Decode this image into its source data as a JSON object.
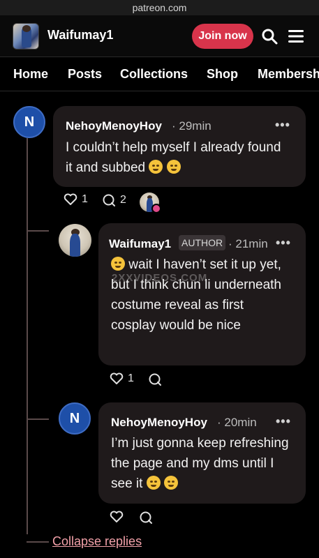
{
  "browser": {
    "url": "patreon.com"
  },
  "header": {
    "creator_name": "Waifumay1",
    "join_label": "Join now",
    "search_icon": "search-icon",
    "menu_icon": "hamburger-menu-icon"
  },
  "nav": {
    "items": [
      {
        "label": "Home"
      },
      {
        "label": "Posts"
      },
      {
        "label": "Collections"
      },
      {
        "label": "Shop"
      },
      {
        "label": "Membersh"
      }
    ]
  },
  "comments": [
    {
      "avatar_letter": "N",
      "author": "NehoyMenoyHoy",
      "time": "· 29min",
      "menu": "•••",
      "text": "I couldn’t help myself I already found it and subbed",
      "likes": "1",
      "replies": "2"
    },
    {
      "author": "Waifumay1",
      "badge": "AUTHOR",
      "time": "· 21min",
      "menu": "•••",
      "text": "wait I haven’t set it up yet, but I think chun li underneath costume reveal as first cosplay would be nice",
      "likes": "1"
    },
    {
      "avatar_letter": "N",
      "author": "NehoyMenoyHoy",
      "time": "· 20min",
      "menu": "•••",
      "text": "I’m just gonna keep refreshing the page and my dms until I see it"
    }
  ],
  "watermark": "2XXVIDEOS.COM",
  "collapse_label": "Collapse replies",
  "colors": {
    "join": "#d8344b",
    "avatar_n": "#1e4fa8",
    "bubble": "#1f1a1b",
    "link": "#f2a1a9"
  }
}
